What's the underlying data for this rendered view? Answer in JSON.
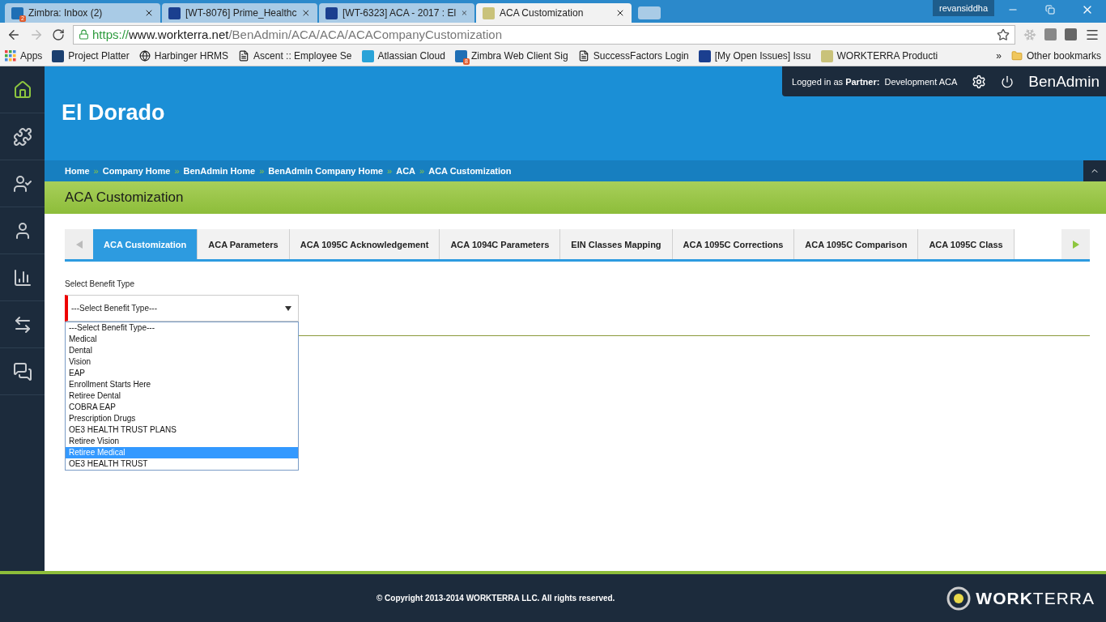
{
  "browser": {
    "tabs": [
      {
        "title": "Zimbra: Inbox (2)",
        "kind": "zimbra",
        "badge": "2",
        "selected": false
      },
      {
        "title": "[WT-8076] Prime_Healthc",
        "kind": "jira",
        "selected": false
      },
      {
        "title": "[WT-6323] ACA - 2017 : El",
        "kind": "jira",
        "selected": false
      },
      {
        "title": "ACA Customization",
        "kind": "workterra",
        "selected": true
      }
    ],
    "user": "revansiddha",
    "url": {
      "scheme": "https://",
      "host": "www.workterra.net",
      "path": "/BenAdmin/ACA/ACA/ACACompanyCustomization"
    },
    "bookmarks": [
      {
        "label": "Apps",
        "kind": "apps"
      },
      {
        "label": "Project Platter",
        "kind": "p"
      },
      {
        "label": "Harbinger HRMS",
        "kind": "globe"
      },
      {
        "label": "Ascent :: Employee Se",
        "kind": "page"
      },
      {
        "label": "Atlassian Cloud",
        "kind": "atlassian"
      },
      {
        "label": "Zimbra Web Client Sig",
        "kind": "zimbra",
        "badge": "8"
      },
      {
        "label": "SuccessFactors Login",
        "kind": "page"
      },
      {
        "label": "[My Open Issues] Issu",
        "kind": "jira"
      },
      {
        "label": "WORKTERRA Producti",
        "kind": "workterra"
      }
    ],
    "more": "»",
    "other_bookmarks": "Other bookmarks"
  },
  "sidebar": {
    "items": [
      {
        "kind": "home",
        "selected": true
      },
      {
        "kind": "puzzle",
        "selected": false
      },
      {
        "kind": "user-star",
        "selected": false
      },
      {
        "kind": "user",
        "selected": false
      },
      {
        "kind": "chart",
        "selected": false
      },
      {
        "kind": "swap",
        "selected": false
      },
      {
        "kind": "chat",
        "selected": false
      }
    ]
  },
  "header": {
    "company": "El Dorado",
    "login": "Logged in as **Partner:**  Development ACA",
    "app_name": "BenAdmin"
  },
  "breadcrumbs": [
    "Home",
    "Company Home",
    "BenAdmin Home",
    "BenAdmin Company Home",
    "ACA",
    "ACA Customization"
  ],
  "breadcrumb_separator": "»",
  "page_title": "ACA Customization",
  "tabs": [
    {
      "label": "ACA Customization",
      "selected": true
    },
    {
      "label": "ACA Parameters",
      "selected": false
    },
    {
      "label": "ACA 1095C Acknowledgement",
      "selected": false
    },
    {
      "label": "ACA 1094C Parameters",
      "selected": false
    },
    {
      "label": "EIN Classes Mapping",
      "selected": false
    },
    {
      "label": "ACA 1095C Corrections",
      "selected": false
    },
    {
      "label": "ACA 1095C Comparison",
      "selected": false
    },
    {
      "label": "ACA 1095C Class",
      "selected": false
    }
  ],
  "benefit_select": {
    "label": "Select Benefit Type",
    "value": "---Select Benefit Type---",
    "expanded": true,
    "options": [
      {
        "label": "---Select Benefit Type---",
        "highlighted": false
      },
      {
        "label": "Medical",
        "highlighted": false
      },
      {
        "label": "Dental",
        "highlighted": false
      },
      {
        "label": "Vision",
        "highlighted": false
      },
      {
        "label": "EAP",
        "highlighted": false
      },
      {
        "label": "Enrollment Starts Here",
        "highlighted": false
      },
      {
        "label": "Retiree Dental",
        "highlighted": false
      },
      {
        "label": "COBRA EAP",
        "highlighted": false
      },
      {
        "label": "Prescription Drugs",
        "highlighted": false
      },
      {
        "label": "OE3 HEALTH TRUST PLANS",
        "highlighted": false
      },
      {
        "label": "Retiree Vision",
        "highlighted": false
      },
      {
        "label": "Retiree Medical",
        "highlighted": true
      },
      {
        "label": "OE3 HEALTH TRUST",
        "highlighted": false
      }
    ]
  },
  "footer": {
    "copyright": "© Copyright 2013-2014 WORKTERRA LLC. All rights reserved.",
    "logo": "**WORK**TERRA"
  }
}
